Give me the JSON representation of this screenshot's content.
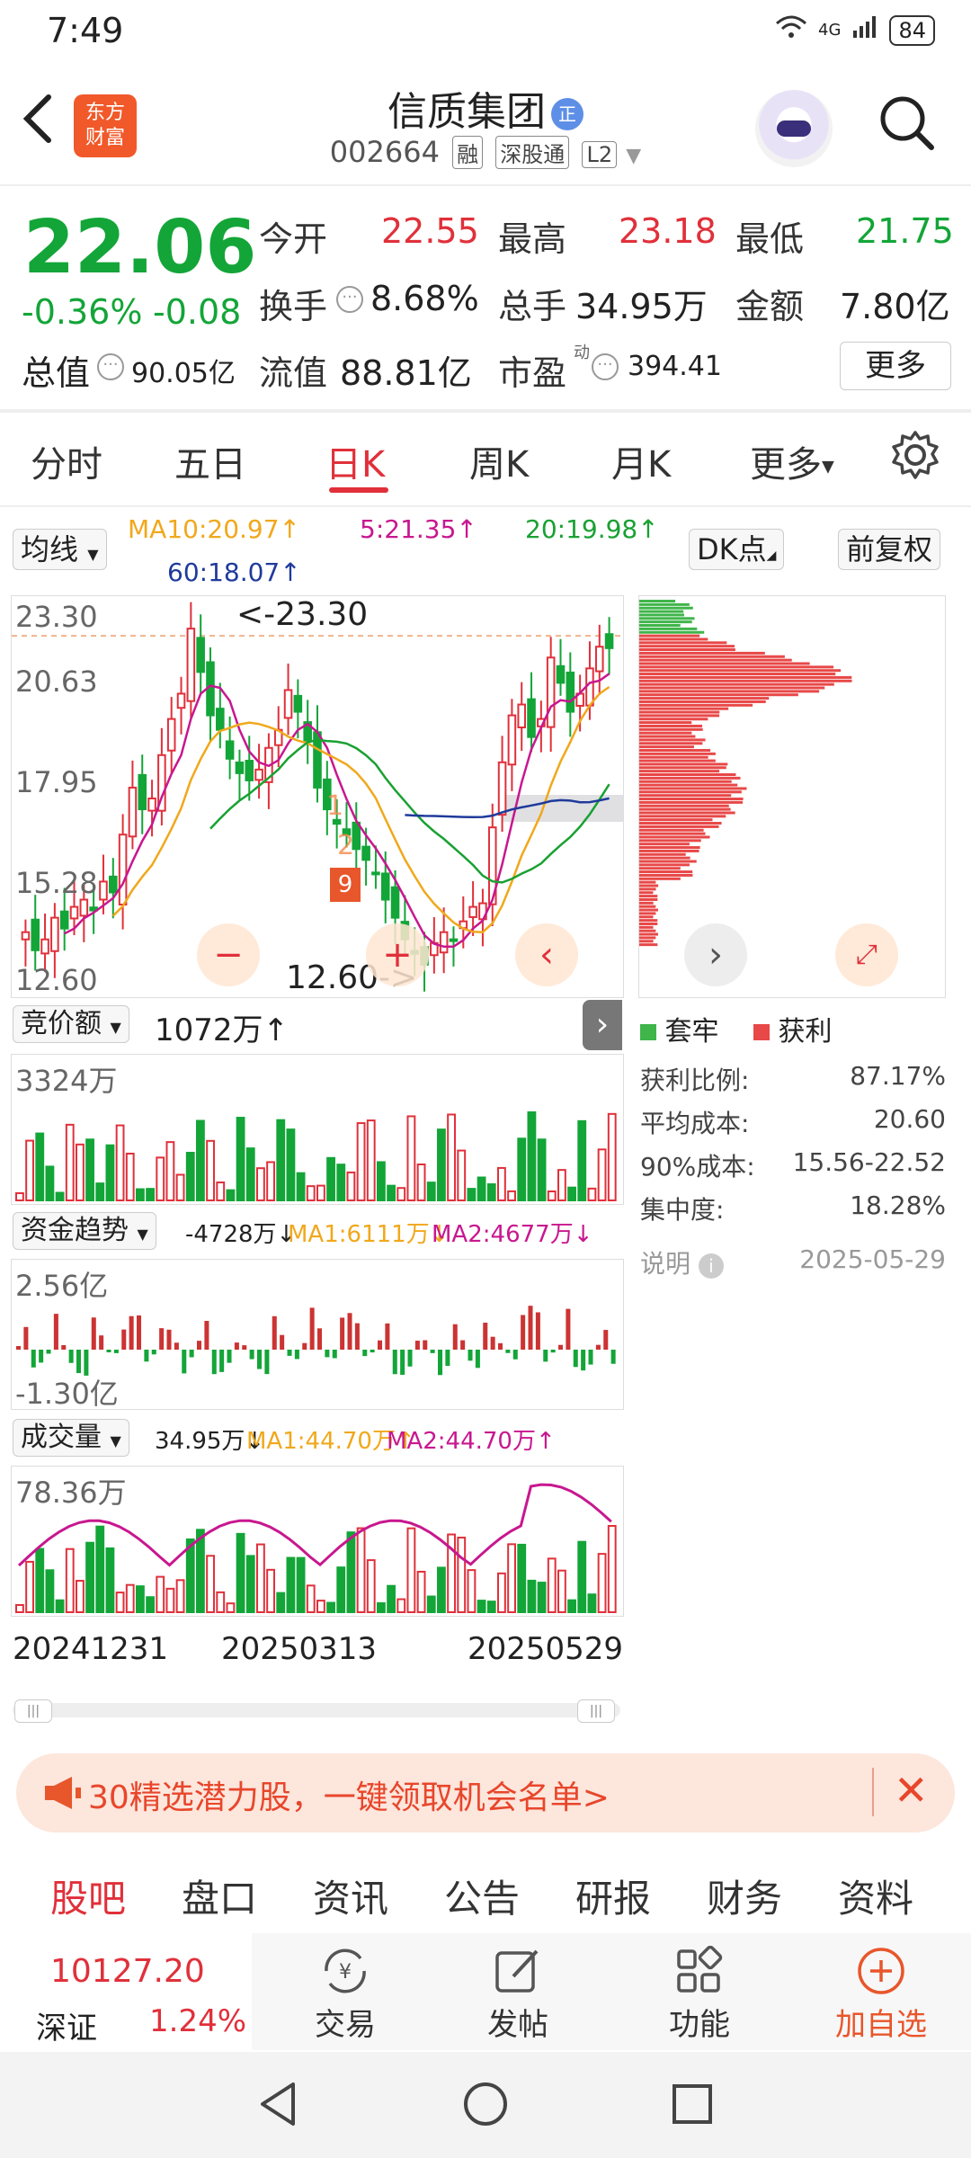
{
  "status": {
    "time": "7:49",
    "signal": "4G",
    "battery": "84"
  },
  "header": {
    "logo_line1": "东方",
    "logo_line2": "财富",
    "name": "信质集团",
    "name_badge": "正",
    "code": "002664",
    "tags": [
      "融",
      "深股通",
      "L2"
    ]
  },
  "quote": {
    "price": "22.06",
    "change_pct": "-0.36%",
    "change": "-0.08",
    "open_label": "今开",
    "open": "22.55",
    "high_label": "最高",
    "high": "23.18",
    "low_label": "最低",
    "low": "21.75",
    "turnover_label": "换手",
    "turnover": "8.68%",
    "volume_label": "总手",
    "volume": "34.95万",
    "amount_label": "金额",
    "amount": "7.80亿",
    "mktcap_label": "总值",
    "mktcap": "90.05亿",
    "float_label": "流值",
    "float": "88.81亿",
    "pe_label": "市盈",
    "pe_sup": "动",
    "pe": "394.41",
    "more_label": "更多"
  },
  "tabs": {
    "items": [
      "分时",
      "五日",
      "日K",
      "周K",
      "月K",
      "更多"
    ],
    "active": "日K"
  },
  "chart_controls": {
    "indicator": "均线",
    "ma10": "MA10:20.97↑",
    "ma5": "5:21.35↑",
    "ma20": "20:19.98↑",
    "ma60": "60:18.07↑",
    "dk": "DK点",
    "adjust": "前复权"
  },
  "colors": {
    "up": "#e0303a",
    "down": "#13a538",
    "ma5": "#c8178f",
    "ma10": "#f0a81c",
    "ma20": "#19a132",
    "ma60": "#1f3a9b"
  },
  "chart_data": [
    {
      "type": "candlestick",
      "yaxis_ticks": [
        "23.30",
        "20.63",
        "17.95",
        "15.28",
        "12.60"
      ],
      "ylim": [
        12.6,
        23.3
      ],
      "annotations": [
        "<-23.30",
        "12.60->"
      ],
      "signal_marks": [
        "1",
        "2",
        "9"
      ],
      "ma_series": [
        "MA5",
        "MA10",
        "MA20",
        "MA60"
      ],
      "close_series": [
        14.2,
        13.7,
        14.0,
        14.6,
        14.3,
        14.9,
        15.1,
        14.8,
        15.6,
        15.3,
        16.9,
        18.2,
        17.6,
        17.9,
        19.1,
        20.1,
        20.8,
        22.6,
        21.4,
        20.2,
        19.8,
        19.0,
        18.6,
        18.4,
        18.7,
        19.3,
        19.8,
        20.9,
        20.3,
        19.5,
        18.2,
        17.6,
        17.2,
        16.9,
        16.5,
        16.2,
        15.8,
        15.1,
        14.6,
        14.0,
        13.6,
        13.3,
        13.9,
        14.2,
        14.0,
        14.5,
        14.9,
        15.0,
        17.1,
        18.9,
        20.2,
        20.5,
        19.6,
        20.1,
        21.8,
        21.1,
        20.3,
        20.8,
        21.5,
        22.1,
        22.06
      ]
    },
    {
      "type": "bar",
      "title": "竞价额",
      "value": "1072万↑",
      "yaxis_top": "3324万"
    },
    {
      "type": "bar",
      "title": "资金趋势",
      "value": "-4728万↓",
      "ma1": "MA1:6111万↓",
      "ma2": "MA2:4677万↓",
      "yaxis_top": "2.56亿",
      "yaxis_bottom": "-1.30亿"
    },
    {
      "type": "bar",
      "title": "成交量",
      "value": "34.95万↓",
      "ma1": "MA1:44.70万↑",
      "ma2": "MA2:44.70万↑",
      "yaxis_top": "78.36万",
      "x_ticks": [
        "20241231",
        "20250313",
        "20250529"
      ]
    },
    {
      "type": "bar",
      "title": "筹码分布",
      "series": [
        "套牢",
        "获利"
      ]
    }
  ],
  "chips": {
    "legend_trapped": "套牢",
    "legend_profit": "获利",
    "rows": [
      {
        "label": "获利比例:",
        "value": "87.17%"
      },
      {
        "label": "平均成本:",
        "value": "20.60"
      },
      {
        "label": "90%成本:",
        "value": "15.56-22.52"
      },
      {
        "label": "集中度:",
        "value": "18.28%"
      }
    ],
    "note_label": "说明",
    "date": "2025-05-29"
  },
  "banner": {
    "text": "30精选潜力股，一键领取机会名单>"
  },
  "bottom_tabs": [
    "股吧",
    "盘口",
    "资讯",
    "公告",
    "研报",
    "财务",
    "资料"
  ],
  "toolbar": {
    "index_value": "10127.20",
    "index_name": "深证",
    "index_change": "1.24%",
    "trade": "交易",
    "post": "发帖",
    "function": "功能",
    "add": "加自选"
  }
}
